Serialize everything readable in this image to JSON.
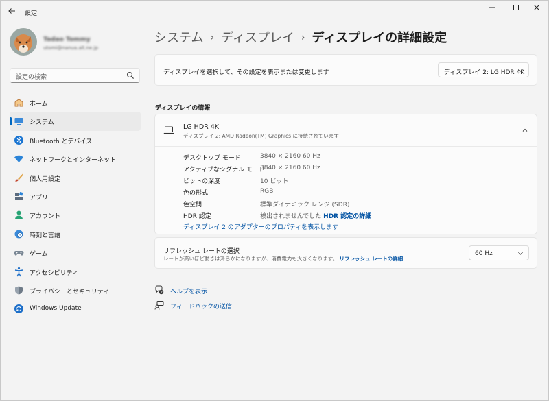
{
  "window": {
    "title": "設定",
    "back_icon": "back-arrow-icon",
    "minimize": "—",
    "maximize": "☐",
    "close": "✕"
  },
  "user": {
    "name": "Tadao Tommy",
    "email": "utomi@nanua.alt.ne.jp"
  },
  "search": {
    "placeholder": "設定の検索"
  },
  "sidebar": {
    "items": [
      {
        "label": "ホーム",
        "icon": "home-icon",
        "active": false
      },
      {
        "label": "システム",
        "icon": "system-icon",
        "active": true
      },
      {
        "label": "Bluetooth とデバイス",
        "icon": "bluetooth-icon",
        "active": false
      },
      {
        "label": "ネットワークとインターネット",
        "icon": "wifi-icon",
        "active": false
      },
      {
        "label": "個人用設定",
        "icon": "brush-icon",
        "active": false
      },
      {
        "label": "アプリ",
        "icon": "apps-icon",
        "active": false
      },
      {
        "label": "アカウント",
        "icon": "account-icon",
        "active": false
      },
      {
        "label": "時刻と言語",
        "icon": "clock-globe-icon",
        "active": false
      },
      {
        "label": "ゲーム",
        "icon": "gamepad-icon",
        "active": false
      },
      {
        "label": "アクセシビリティ",
        "icon": "accessibility-icon",
        "active": false
      },
      {
        "label": "プライバシーとセキュリティ",
        "icon": "shield-icon",
        "active": false
      },
      {
        "label": "Windows Update",
        "icon": "update-icon",
        "active": false
      }
    ]
  },
  "breadcrumb": {
    "item1": "システム",
    "item2": "ディスプレイ",
    "current": "ディスプレイの詳細設定",
    "separator": "›"
  },
  "display_select": {
    "label": "ディスプレイを選択して、その設定を表示または変更します",
    "value": "ディスプレイ 2: LG HDR 4K"
  },
  "section_title": "ディスプレイの情報",
  "display_info": {
    "name": "LG HDR 4K",
    "subtitle": "ディスプレイ 2: AMD Radeon(TM) Graphics に接続されています",
    "props": [
      {
        "key": "デスクトップ モード",
        "value": "3840 × 2160 60 Hz"
      },
      {
        "key": "アクティブなシグナル モード",
        "value": "3840 × 2160 60 Hz"
      },
      {
        "key": "ビットの深度",
        "value": "10 ビット"
      },
      {
        "key": "色の形式",
        "value": "RGB"
      },
      {
        "key": "色空間",
        "value": "標準ダイナミック レンジ (SDR)"
      }
    ],
    "hdr_key": "HDR 認定",
    "hdr_value": "検出されませんでした",
    "hdr_link": "HDR 認定の詳細",
    "adapter_link": "ディスプレイ 2 のアダプターのプロパティを表示します"
  },
  "refresh": {
    "title": "リフレッシュ レートの選択",
    "desc": "レートが高いほど動きは滑らかになりますが、消費電力も大きくなります。",
    "link": "リフレッシュ レートの詳細",
    "value": "60 Hz"
  },
  "help": {
    "label": "ヘルプを表示",
    "icon": "help-icon"
  },
  "feedback": {
    "label": "フィードバックの送信",
    "icon": "feedback-icon"
  },
  "colors": {
    "accent": "#0067c0",
    "link": "#0052a3"
  }
}
